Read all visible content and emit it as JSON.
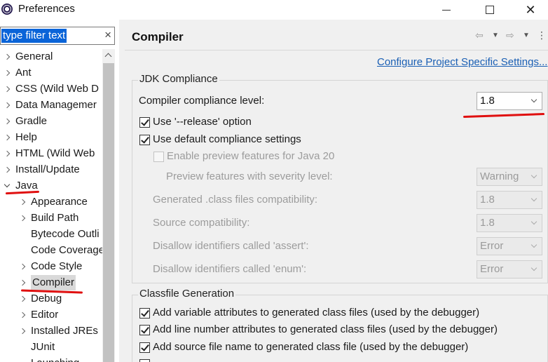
{
  "window": {
    "title": "Preferences",
    "controls": [
      "minimize",
      "maximize",
      "close"
    ]
  },
  "filter": {
    "value": "type filter text",
    "clear_glyph": "×"
  },
  "tree": {
    "items": [
      {
        "label": "General",
        "level": 0,
        "state": "collapsed"
      },
      {
        "label": "Ant",
        "level": 0,
        "state": "collapsed"
      },
      {
        "label": "CSS (Wild Web D",
        "level": 0,
        "state": "collapsed"
      },
      {
        "label": "Data Managemer",
        "level": 0,
        "state": "collapsed"
      },
      {
        "label": "Gradle",
        "level": 0,
        "state": "collapsed"
      },
      {
        "label": "Help",
        "level": 0,
        "state": "collapsed"
      },
      {
        "label": "HTML (Wild Web",
        "level": 0,
        "state": "collapsed"
      },
      {
        "label": "Install/Update",
        "level": 0,
        "state": "collapsed"
      },
      {
        "label": "Java",
        "level": 0,
        "state": "expanded"
      },
      {
        "label": "Appearance",
        "level": 1,
        "state": "collapsed"
      },
      {
        "label": "Build Path",
        "level": 1,
        "state": "collapsed"
      },
      {
        "label": "Bytecode Outli",
        "level": 1,
        "state": "leaf"
      },
      {
        "label": "Code Coverage",
        "level": 1,
        "state": "leaf"
      },
      {
        "label": "Code Style",
        "level": 1,
        "state": "collapsed"
      },
      {
        "label": "Compiler",
        "level": 1,
        "state": "collapsed",
        "selected": true
      },
      {
        "label": "Debug",
        "level": 1,
        "state": "collapsed"
      },
      {
        "label": "Editor",
        "level": 1,
        "state": "collapsed"
      },
      {
        "label": "Installed JREs",
        "level": 1,
        "state": "collapsed"
      },
      {
        "label": "JUnit",
        "level": 1,
        "state": "leaf"
      },
      {
        "label": "Launching",
        "level": 1,
        "state": "leaf"
      }
    ]
  },
  "page": {
    "title": "Compiler",
    "configure_link": "Configure Project Specific Settings..."
  },
  "jdk": {
    "group_title": "JDK Compliance",
    "compliance_label": "Compiler compliance level:",
    "compliance_value": "1.8",
    "release_option": "Use '--release' option",
    "release_checked": true,
    "default_settings": "Use default compliance settings",
    "default_checked": true,
    "preview_features": "Enable preview features for Java 20",
    "preview_checked": false,
    "preview_severity_label": "Preview features with severity level:",
    "preview_severity_value": "Warning",
    "generated_label": "Generated .class files compatibility:",
    "generated_value": "1.8",
    "source_label": "Source compatibility:",
    "source_value": "1.8",
    "assert_label": "Disallow identifiers called 'assert':",
    "assert_value": "Error",
    "enum_label": "Disallow identifiers called 'enum':",
    "enum_value": "Error"
  },
  "classfile": {
    "group_title": "Classfile Generation",
    "options": [
      {
        "label": "Add variable attributes to generated class files (used by the debugger)",
        "checked": true
      },
      {
        "label": "Add line number attributes to generated class files (used by the debugger)",
        "checked": true
      },
      {
        "label": "Add source file name to generated class file (used by the debugger)",
        "checked": true
      }
    ]
  },
  "colors": {
    "selection": "#0a64d8",
    "link": "#1a5fb4",
    "annotation": "#e01010"
  }
}
